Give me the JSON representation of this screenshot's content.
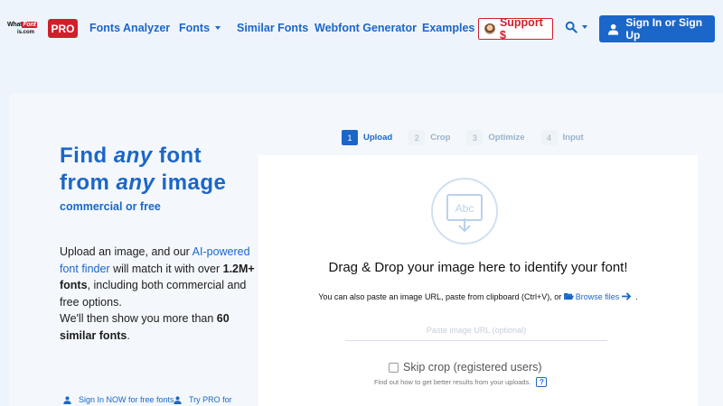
{
  "nav": {
    "logo_top_left": "What",
    "logo_top_badge": "Font",
    "logo_bottom": "is.com",
    "pro_badge": "PRO",
    "links": [
      "Fonts Analyzer",
      "Fonts",
      "Similar Fonts",
      "Webfont Generator",
      "Examples"
    ],
    "support_label": "Support $",
    "signin_label": "Sign In or Sign Up"
  },
  "hero": {
    "line1_a": "Find ",
    "line1_b": "any",
    "line1_c": " font",
    "line2_a": "from ",
    "line2_b": "any",
    "line2_c": " image",
    "subtitle": "commercial or free",
    "desc_1": "Upload an image, and our ",
    "desc_link": "AI-powered font finder",
    "desc_2": " will match it with over ",
    "desc_bold1": "1.2M+ fonts",
    "desc_3": ", including both commercial and free options.",
    "desc_4": "We'll then show you more than ",
    "desc_bold2": "60 similar fonts",
    "desc_5": ".",
    "foot_signin": "Sign In NOW for free fonts",
    "foot_pro": "Try PRO for"
  },
  "steps": [
    {
      "num": "1",
      "label": "Upload"
    },
    {
      "num": "2",
      "label": "Crop"
    },
    {
      "num": "3",
      "label": "Optimize"
    },
    {
      "num": "4",
      "label": "Input"
    }
  ],
  "upload": {
    "icon_text": "Abc",
    "drop_text": "Drag & Drop your image here to identify your font!",
    "alt_text": "You can also paste an image URL, paste from clipboard (Ctrl+V), or ",
    "browse": "Browse files",
    "alt_end": " .",
    "url_placeholder": "Paste image URL (optional)",
    "skip_crop": "Skip crop (registered users)",
    "tips": "Find out how to get better results from your uploads.",
    "help": "?"
  },
  "colors": {
    "brand_blue": "#1b66c9",
    "brand_red": "#d21e2b",
    "background": "#eef4fb"
  }
}
